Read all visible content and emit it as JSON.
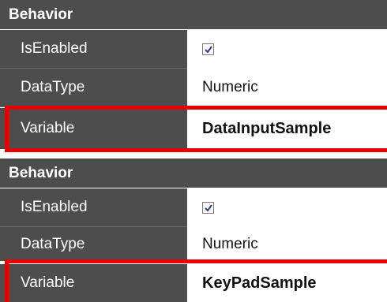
{
  "panels": [
    {
      "header": "Behavior",
      "rows": [
        {
          "label": "IsEnabled",
          "type": "checkbox",
          "checked": true
        },
        {
          "label": "DataType",
          "value": "Numeric"
        },
        {
          "label": "Variable",
          "value": "DataInputSample",
          "highlighted": true
        }
      ]
    },
    {
      "header": "Behavior",
      "rows": [
        {
          "label": "IsEnabled",
          "type": "checkbox",
          "checked": true
        },
        {
          "label": "DataType",
          "value": "Numeric"
        },
        {
          "label": "Variable",
          "value": "KeyPadSample",
          "highlighted": true
        }
      ]
    }
  ],
  "colors": {
    "label_bg": "#4d4d4d",
    "highlight": "#e60000",
    "checkmark": "#2b3a8f"
  }
}
